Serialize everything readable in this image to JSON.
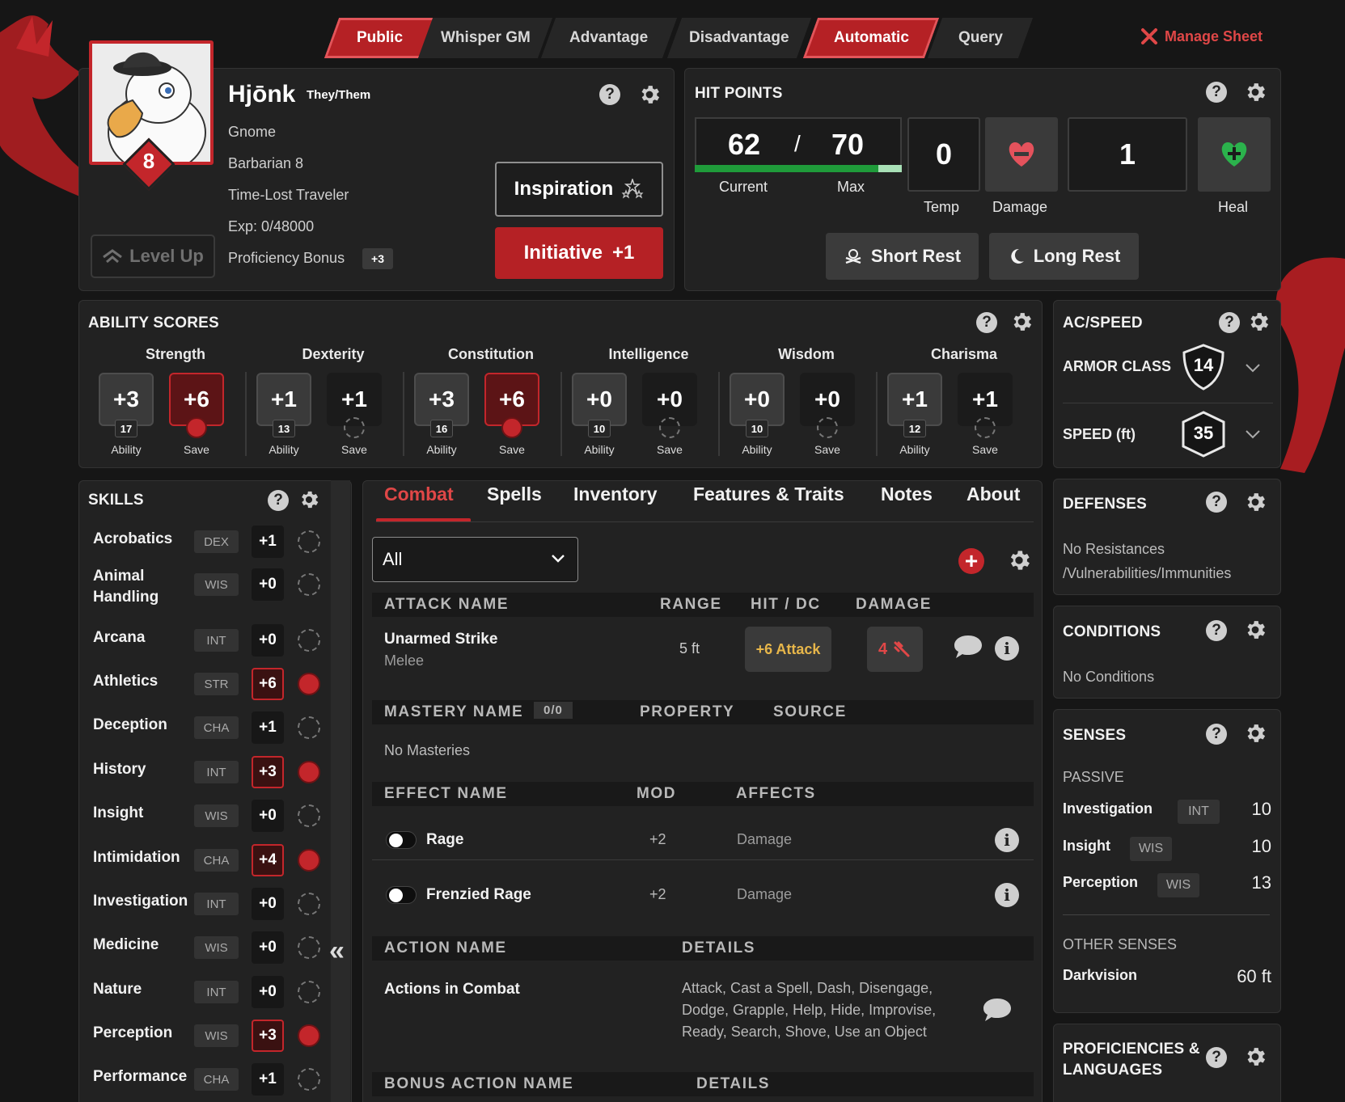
{
  "toggles": [
    "Public",
    "Whisper GM",
    "Advantage",
    "Disadvantage",
    "Automatic",
    "Query"
  ],
  "manage_sheet": "Manage Sheet",
  "character": {
    "name": "Hjōnk",
    "pronouns": "They/Them",
    "race": "Gnome",
    "class": "Barbarian 8",
    "background": "Time-Lost Traveler",
    "exp": "Exp: 0/48000",
    "proficiency_label": "Proficiency Bonus",
    "proficiency_value": "+3",
    "level": "8",
    "level_up": "Level Up",
    "inspiration": "Inspiration",
    "initiative_label": "Initiative",
    "initiative_value": "+1"
  },
  "hit_points": {
    "title": "HIT POINTS",
    "current": "62",
    "separator": "/",
    "max": "70",
    "current_label": "Current",
    "max_label": "Max",
    "temp": "0",
    "temp_label": "Temp",
    "damage_label": "Damage",
    "amount": "1",
    "heal_label": "Heal",
    "short_rest": "Short Rest",
    "long_rest": "Long Rest",
    "fill_fraction": 0.886
  },
  "ability_scores": {
    "title": "ABILITY SCORES",
    "ability_label": "Ability",
    "save_label": "Save",
    "items": [
      {
        "name": "Strength",
        "mod": "+3",
        "score": "17",
        "save": "+6",
        "save_prof": true
      },
      {
        "name": "Dexterity",
        "mod": "+1",
        "score": "13",
        "save": "+1",
        "save_prof": false
      },
      {
        "name": "Constitution",
        "mod": "+3",
        "score": "16",
        "save": "+6",
        "save_prof": true
      },
      {
        "name": "Intelligence",
        "mod": "+0",
        "score": "10",
        "save": "+0",
        "save_prof": false
      },
      {
        "name": "Wisdom",
        "mod": "+0",
        "score": "10",
        "save": "+0",
        "save_prof": false
      },
      {
        "name": "Charisma",
        "mod": "+1",
        "score": "12",
        "save": "+1",
        "save_prof": false
      }
    ]
  },
  "ac_speed": {
    "title": "AC/SPEED",
    "armor_class_label": "ARMOR CLASS",
    "armor_class": "14",
    "speed_label": "SPEED (ft)",
    "speed": "35"
  },
  "skills": {
    "title": "SKILLS",
    "items": [
      {
        "name": "Acrobatics",
        "attr": "DEX",
        "mod": "+1",
        "prof": false
      },
      {
        "name": "Animal Handling",
        "attr": "WIS",
        "mod": "+0",
        "prof": false
      },
      {
        "name": "Arcana",
        "attr": "INT",
        "mod": "+0",
        "prof": false
      },
      {
        "name": "Athletics",
        "attr": "STR",
        "mod": "+6",
        "prof": true
      },
      {
        "name": "Deception",
        "attr": "CHA",
        "mod": "+1",
        "prof": false
      },
      {
        "name": "History",
        "attr": "INT",
        "mod": "+3",
        "prof": true
      },
      {
        "name": "Insight",
        "attr": "WIS",
        "mod": "+0",
        "prof": false
      },
      {
        "name": "Intimidation",
        "attr": "CHA",
        "mod": "+4",
        "prof": true
      },
      {
        "name": "Investigation",
        "attr": "INT",
        "mod": "+0",
        "prof": false
      },
      {
        "name": "Medicine",
        "attr": "WIS",
        "mod": "+0",
        "prof": false
      },
      {
        "name": "Nature",
        "attr": "INT",
        "mod": "+0",
        "prof": false
      },
      {
        "name": "Perception",
        "attr": "WIS",
        "mod": "+3",
        "prof": true
      },
      {
        "name": "Performance",
        "attr": "CHA",
        "mod": "+1",
        "prof": false
      }
    ]
  },
  "tabs": [
    "Combat",
    "Spells",
    "Inventory",
    "Features & Traits",
    "Notes",
    "About"
  ],
  "combat": {
    "filter": "All",
    "attack_headers": [
      "ATTACK NAME",
      "RANGE",
      "HIT / DC",
      "DAMAGE"
    ],
    "attack": {
      "name": "Unarmed Strike",
      "type": "Melee",
      "range": "5 ft",
      "hit": "+6 Attack",
      "damage": "4"
    },
    "mastery_headers": [
      "MASTERY NAME",
      "PROPERTY",
      "SOURCE"
    ],
    "mastery_count": "0/0",
    "no_masteries": "No Masteries",
    "effect_headers": [
      "EFFECT NAME",
      "MOD",
      "AFFECTS"
    ],
    "effects": [
      {
        "name": "Rage",
        "mod": "+2",
        "affects": "Damage"
      },
      {
        "name": "Frenzied Rage",
        "mod": "+2",
        "affects": "Damage"
      }
    ],
    "action_headers": [
      "ACTION NAME",
      "DETAILS"
    ],
    "action": {
      "name": "Actions in Combat",
      "details_1": "Attack, Cast a Spell, Dash, Disengage,",
      "details_2": "Dodge, Grapple, Help, Hide, Improvise,",
      "details_3": "Ready, Search, Shove, Use an Object"
    },
    "bonus_headers": [
      "BONUS ACTION NAME",
      "DETAILS"
    ]
  },
  "defenses": {
    "title": "DEFENSES",
    "line1": "No Resistances",
    "line2": "/Vulnerabilities/Immunities"
  },
  "conditions": {
    "title": "CONDITIONS",
    "text": "No Conditions"
  },
  "senses": {
    "title": "SENSES",
    "passive_label": "PASSIVE",
    "passive": [
      {
        "name": "Investigation",
        "attr": "INT",
        "value": "10"
      },
      {
        "name": "Insight",
        "attr": "WIS",
        "value": "10"
      },
      {
        "name": "Perception",
        "attr": "WIS",
        "value": "13"
      }
    ],
    "other_label": "OTHER SENSES",
    "darkvision_label": "Darkvision",
    "darkvision_value": "60 ft"
  },
  "proficiencies": {
    "title_1": "PROFICIENCIES &",
    "title_2": "LANGUAGES"
  },
  "colors": {
    "accent": "#c3262b",
    "heal": "#2bb24c",
    "background": "#161616"
  }
}
